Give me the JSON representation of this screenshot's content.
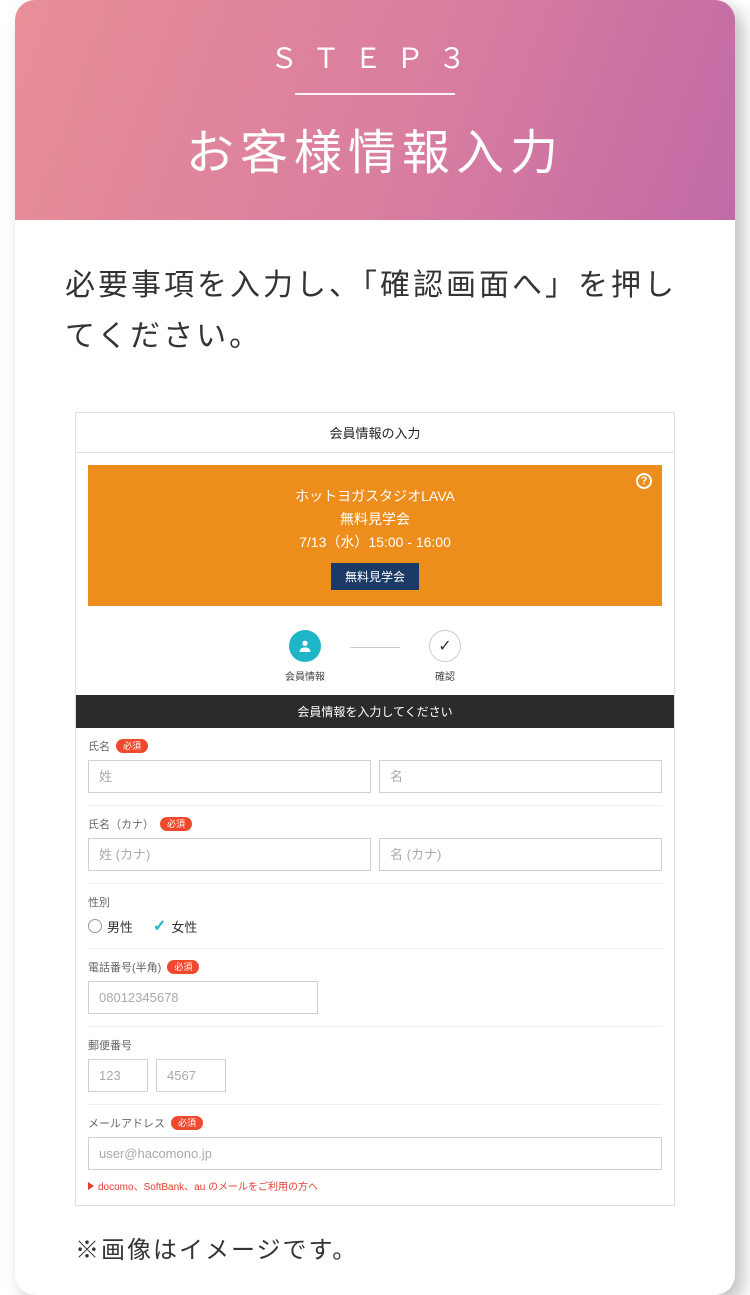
{
  "hero": {
    "step": "ＳＴＥＰ３",
    "title": "お客様情報入力"
  },
  "lead": "必要事項を入力し、「確認画面へ」を押してください。",
  "embed": {
    "header": "会員情報の入力",
    "eventBox": {
      "studio": "ホットヨガスタジオLAVA",
      "eventName": "無料見学会",
      "datetime": "7/13（水）15:00 - 16:00",
      "badge": "無料見学会",
      "help": "?"
    },
    "stepper": {
      "step1": "会員情報",
      "step2": "確認",
      "checkGlyph": "✓"
    },
    "darkBar": "会員情報を入力してください",
    "fields": {
      "name": {
        "label": "氏名",
        "required": "必須",
        "ph_last": "姓",
        "ph_first": "名"
      },
      "nameKana": {
        "label": "氏名（カナ）",
        "required": "必須",
        "ph_last": "姓 (カナ)",
        "ph_first": "名 (カナ)"
      },
      "gender": {
        "label": "性別",
        "opt_male": "男性",
        "opt_female": "女性",
        "selected": "female"
      },
      "phone": {
        "label": "電話番号(半角)",
        "required": "必須",
        "placeholder": "08012345678"
      },
      "postal": {
        "label": "郵便番号",
        "ph1": "123",
        "ph2": "4567"
      },
      "email": {
        "label": "メールアドレス",
        "required": "必須",
        "placeholder": "user@hacomono.jp",
        "carrierNote": "docomo、SoftBank、au のメールをご利用の方へ"
      }
    }
  },
  "footnote": "※画像はイメージです。"
}
